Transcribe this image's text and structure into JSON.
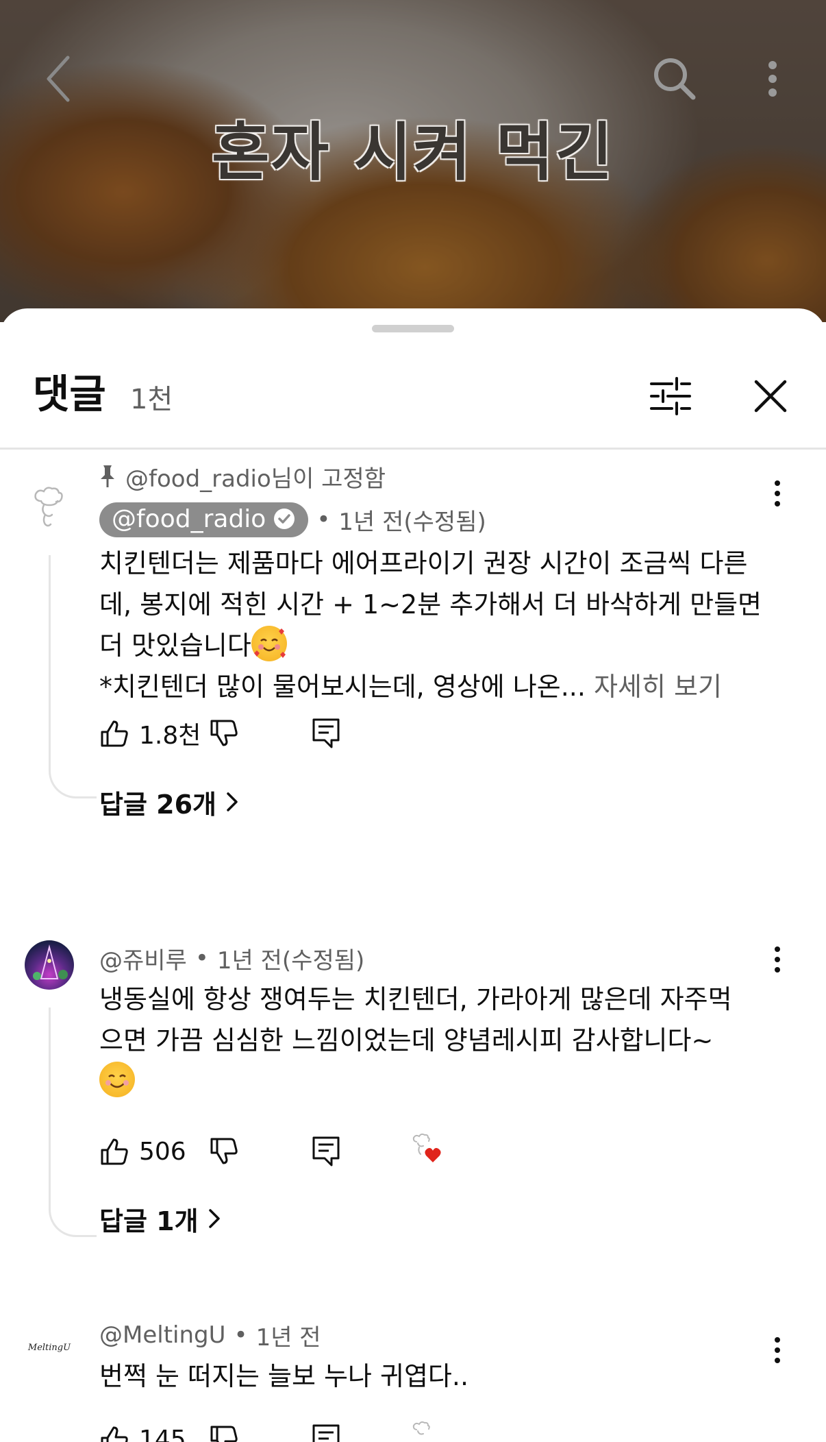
{
  "video": {
    "caption": "혼자 시켜 먹긴"
  },
  "sheet": {
    "title": "댓글",
    "count": "1천"
  },
  "comments": [
    {
      "pinned_label": "@food_radio님이 고정함",
      "author": "@food_radio",
      "verified": true,
      "time": "1년 전(수정됨)",
      "text_lines": [
        "치킨텐더는 제품마다 에어프라이기 권장 시간이 조금씩 다른",
        "데, 봉지에 적힌 시간 + 1~2분 추가해서 더 바삭하게 만들면",
        "더 맛있습니다"
      ],
      "text_line4": "*치킨텐더 많이 물어보시는데, 영상에 나온...",
      "more_label": "자세히 보기",
      "likes": "1.8천",
      "replies_label": "답글 26개"
    },
    {
      "author": "@쥬비루",
      "time": "1년 전(수정됨)",
      "text_lines": [
        "냉동실에 항상 쟁여두는 치킨텐더, 가라아게 많은데 자주먹",
        "으면 가끔 심심한 느낌이었는데 양념레시피 감사합니다~"
      ],
      "likes": "506",
      "creator_hearted": true,
      "replies_label": "답글 1개"
    },
    {
      "author": "@MeltingU",
      "avatar_text": "MeltingU",
      "time": "1년 전",
      "text_lines": [
        "번쩍 눈 떠지는 늘보 누나 귀엽다.."
      ],
      "likes": "145"
    }
  ],
  "icons": {
    "back": "chevron-left-icon",
    "search": "search-icon",
    "more": "more-vertical-icon",
    "filter": "sliders-icon",
    "close": "close-icon",
    "like": "thumbs-up-icon",
    "dislike": "thumbs-down-icon",
    "reply": "comment-icon",
    "heart": "heart-icon",
    "pin": "pin-icon"
  },
  "colors": {
    "text_primary": "#0f0f0f",
    "text_secondary": "#606060",
    "chip_bg": "#8c8c8c",
    "heart": "#e0241b"
  }
}
